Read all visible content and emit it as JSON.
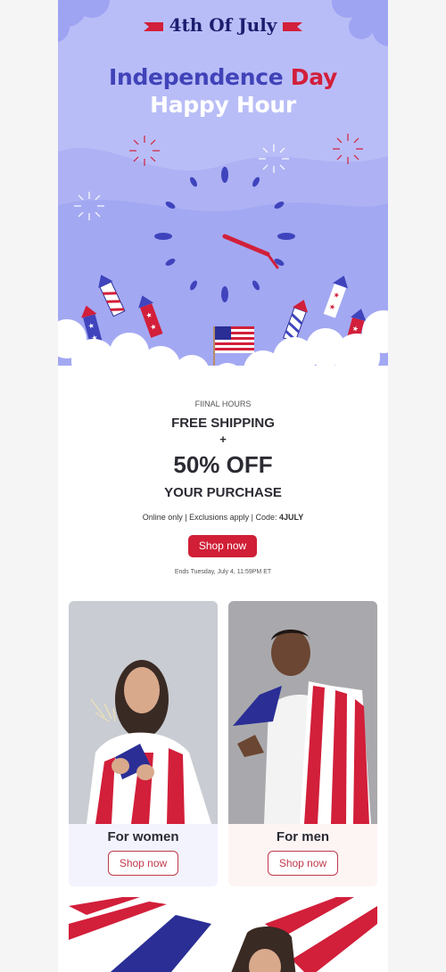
{
  "header": {
    "ribbon_title": "4th Of July",
    "headline_part1": "Independence ",
    "headline_part2": "Day",
    "headline_line2": "Happy Hour"
  },
  "offer": {
    "eyebrow": "FIINAL HOURS",
    "line1": "FREE SHIPPING",
    "plus": "+",
    "discount": "50% OFF",
    "line3": "YOUR PURCHASE",
    "terms_prefix": "Online only | Exclusions apply | Code: ",
    "code": "4JULY",
    "cta_label": "Shop now",
    "ends": "Ends Tuesday, July 4, 11:59PM ET"
  },
  "cards": [
    {
      "caption": "For women",
      "cta_label": "Shop now"
    },
    {
      "caption": "For men",
      "cta_label": "Shop now"
    }
  ],
  "colors": {
    "hero_bg": "#b9bdf7",
    "brand_blue": "#4043b8",
    "brand_red": "#d21f3a",
    "cta_red": "#d01f36"
  },
  "icons": [
    "firework-icon",
    "rocket-firework-icon",
    "clock-icon",
    "us-flag-icon",
    "cloud-icon"
  ]
}
